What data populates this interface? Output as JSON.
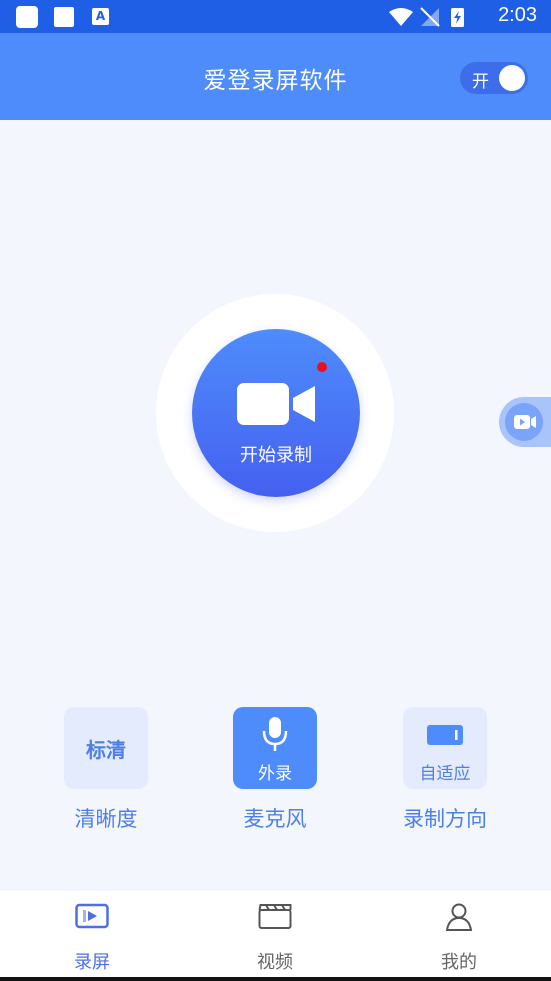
{
  "status_bar": {
    "time": "2:03",
    "notif_letter": "A"
  },
  "app_bar": {
    "title": "爱登录屏软件",
    "toggle_label": "开"
  },
  "record": {
    "label": "开始录制"
  },
  "options": {
    "quality": {
      "badge": "标清",
      "label": "清晰度"
    },
    "mic": {
      "badge": "外录",
      "label": "麦克风"
    },
    "direction": {
      "badge": "自适应",
      "label": "录制方向"
    }
  },
  "nav": {
    "items": [
      {
        "label": "录屏",
        "icon": "screen-record-icon"
      },
      {
        "label": "视频",
        "icon": "clapperboard-icon"
      },
      {
        "label": "我的",
        "icon": "user-icon"
      }
    ]
  },
  "colors": {
    "status_bar": "#1f5fe6",
    "primary": "#4e8cfb",
    "background": "#f3f6fd",
    "accent_text": "#4e7fe6",
    "record_dot": "#e8101f"
  }
}
